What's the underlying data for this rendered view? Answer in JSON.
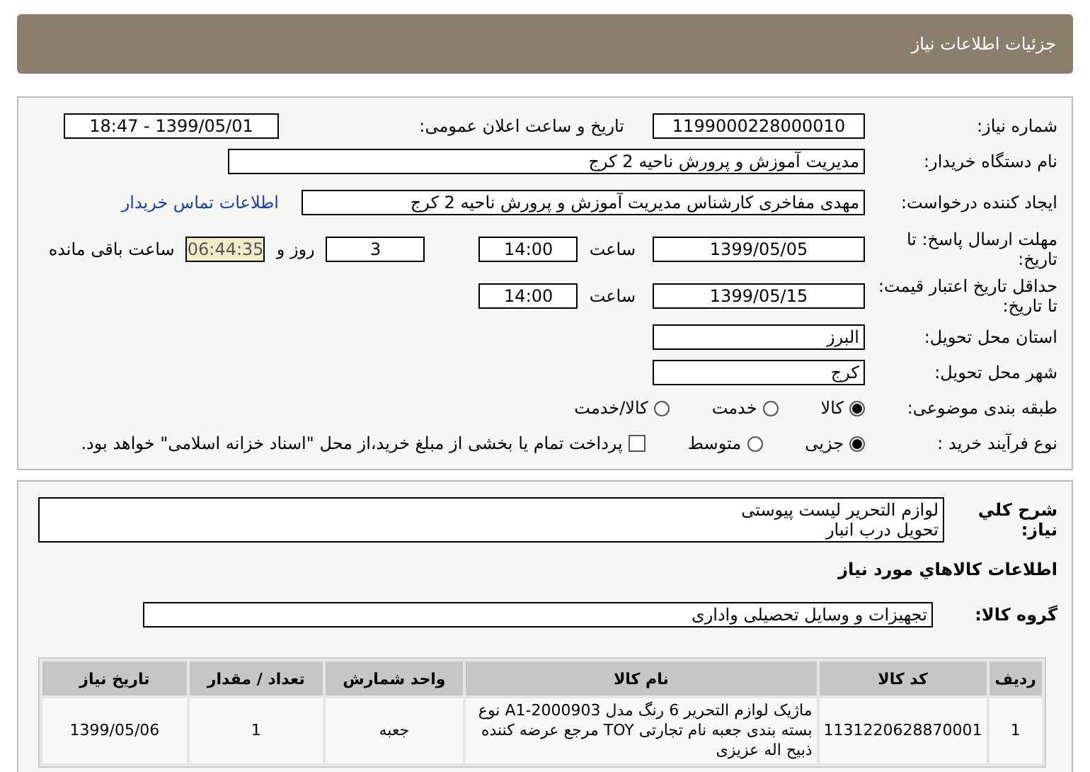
{
  "header": {
    "title": "جزئیات اطلاعات نیاز"
  },
  "details": {
    "need_number": {
      "label": "شماره نیاز:",
      "value": "1199000228000010"
    },
    "announce": {
      "label": "تاریخ و ساعت اعلان عمومی:",
      "value": "1399/05/01 - 18:47"
    },
    "buyer": {
      "label": "نام دستگاه خریدار:",
      "value": "مدیریت آموزش و پرورش ناحیه 2 کرج"
    },
    "creator": {
      "label": "ایجاد کننده درخواست:",
      "value": "مهدی مفاخری کارشناس مدیریت آموزش و پرورش ناحیه 2 کرج",
      "link": "اطلاعات تماس خریدار"
    },
    "deadline": {
      "label": "مهلت ارسال پاسخ: تا تاریخ:",
      "date": "1399/05/05",
      "time_label": "ساعت",
      "time": "14:00",
      "days": "3",
      "days_label": "روز و",
      "remaining": "06:44:35",
      "remaining_label": "ساعت باقی مانده"
    },
    "validity": {
      "label": "حداقل تاریخ اعتبار قیمت: تا تاریخ:",
      "date": "1399/05/15",
      "time_label": "ساعت",
      "time": "14:00"
    },
    "province": {
      "label": "استان محل تحویل:",
      "value": "البرز"
    },
    "city": {
      "label": "شهر محل تحویل:",
      "value": "کرج"
    },
    "category": {
      "label": "طبقه بندی موضوعی:",
      "options": [
        {
          "label": "کالا",
          "selected": true
        },
        {
          "label": "خدمت",
          "selected": false
        },
        {
          "label": "کالا/خدمت",
          "selected": false
        }
      ]
    },
    "process": {
      "label": "نوع فرآیند خرید :",
      "options": [
        {
          "label": "جزیی",
          "selected": true
        },
        {
          "label": "متوسط",
          "selected": false
        }
      ],
      "treasury": {
        "label": "پرداخت تمام یا بخشی از مبلغ خرید،از محل \"اسناد خزانه اسلامی\" خواهد بود.",
        "checked": false
      }
    }
  },
  "goods": {
    "description": {
      "label": "شرح کلي نیاز:",
      "lines": [
        "لوازم التحریر لیست پیوستی",
        "تحویل درب انبار"
      ]
    },
    "heading": "اطلاعات کالاهاي مورد نیاز",
    "group": {
      "label": "گروه کالا:",
      "value": "تجهیزات و وسایل تحصیلی واداری"
    },
    "table": {
      "columns": [
        "ردیف",
        "کد کالا",
        "نام کالا",
        "واحد شمارش",
        "تعداد / مقدار",
        "تاریخ نیاز"
      ],
      "rows": [
        [
          "1",
          "1131220628870001",
          "ماژیک لوازم التحریر 6 رنگ مدل A1-2000903 نوع بسته بندی جعبه نام تجارتی TOY مرجع عرضه کننده ذبیح اله عزیزی",
          "جعبه",
          "1",
          "1399/05/06"
        ]
      ]
    }
  }
}
